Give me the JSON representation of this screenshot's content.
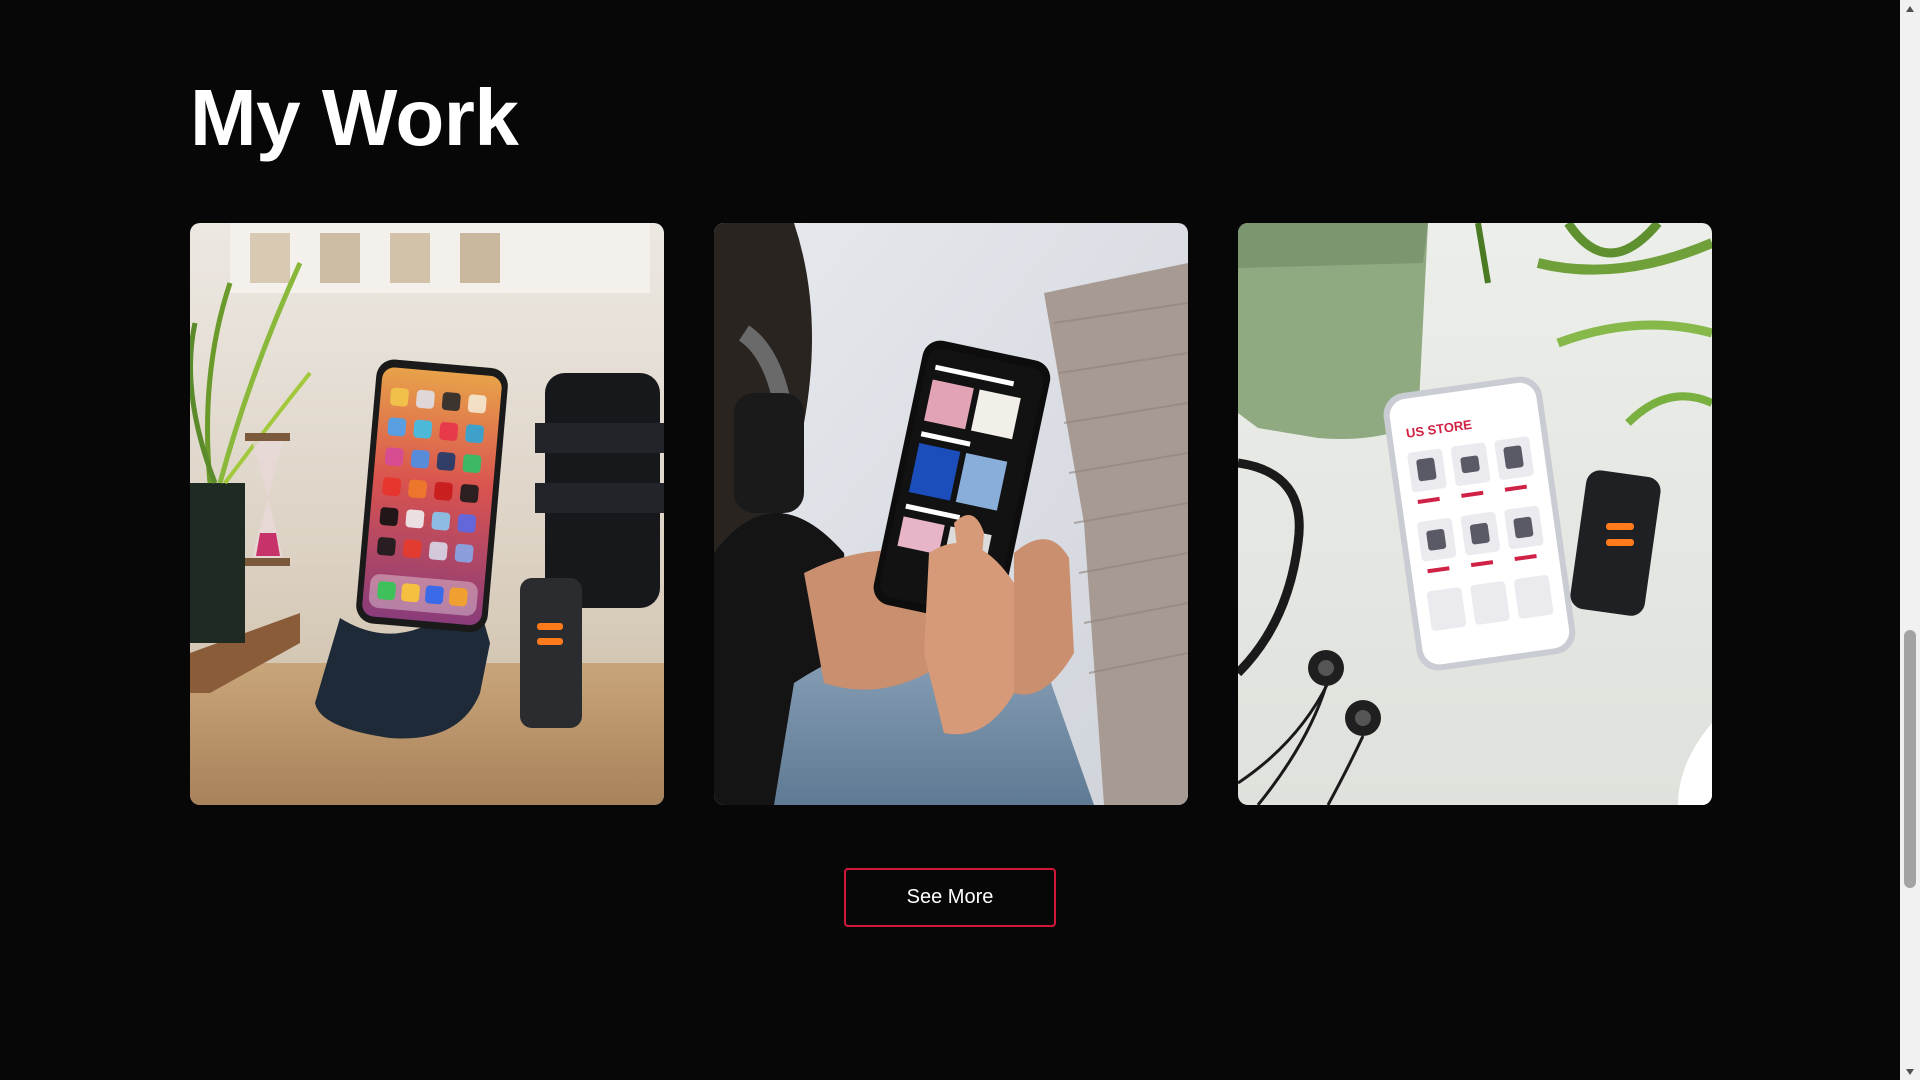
{
  "section": {
    "title": "My Work"
  },
  "projects": [
    {
      "name": "phone-on-stand-app-grid",
      "icon": "project-image-1"
    },
    {
      "name": "music-streaming-app",
      "icon": "project-image-2"
    },
    {
      "name": "us-store-shopping-app",
      "icon": "project-image-3"
    }
  ],
  "project_3_screen": {
    "brand": "US STORE"
  },
  "see_more": {
    "label": "See More",
    "border_color": "#d1183a"
  },
  "colors": {
    "background": "#080708",
    "title": "#ffffff",
    "accent": "#d1183a"
  }
}
